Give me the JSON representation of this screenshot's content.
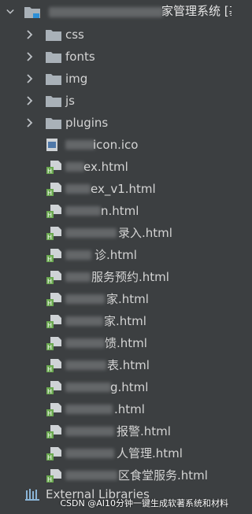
{
  "root": {
    "name": "家管理系统 [基础",
    "expanded": true
  },
  "folders": [
    {
      "label": "css"
    },
    {
      "label": "fonts"
    },
    {
      "label": "img"
    },
    {
      "label": "js"
    },
    {
      "label": "plugins"
    }
  ],
  "files": [
    {
      "label": "icon.ico",
      "type": "ico"
    },
    {
      "label": "ex.html",
      "type": "html"
    },
    {
      "label": "ex_v1.html",
      "type": "html"
    },
    {
      "label": "n.html",
      "type": "html"
    },
    {
      "label": "录入.html",
      "type": "html"
    },
    {
      "label": "诊.html",
      "type": "html"
    },
    {
      "label": "服务预约.html",
      "type": "html"
    },
    {
      "label": "家.html",
      "type": "html"
    },
    {
      "label": "家.html",
      "type": "html"
    },
    {
      "label": "馈.html",
      "type": "html"
    },
    {
      "label": "表.html",
      "type": "html"
    },
    {
      "label": "g.html",
      "type": "html"
    },
    {
      "label": ".html",
      "type": "html"
    },
    {
      "label": "报警.html",
      "type": "html"
    },
    {
      "label": "人管理.html",
      "type": "html"
    },
    {
      "label": "区食堂服务.html",
      "type": "html"
    }
  ],
  "external": {
    "label": "External Libraries"
  },
  "watermark": "CSDN @AI10分钟一键生成软著系统和材料",
  "colors": {
    "background": "#3c3f41",
    "text": "#d4d4d4",
    "folder": "#a9b1b8",
    "html_badge": "#6aa84f",
    "html_accent": "#8dc63f",
    "ico_badge": "#4f78a8"
  }
}
